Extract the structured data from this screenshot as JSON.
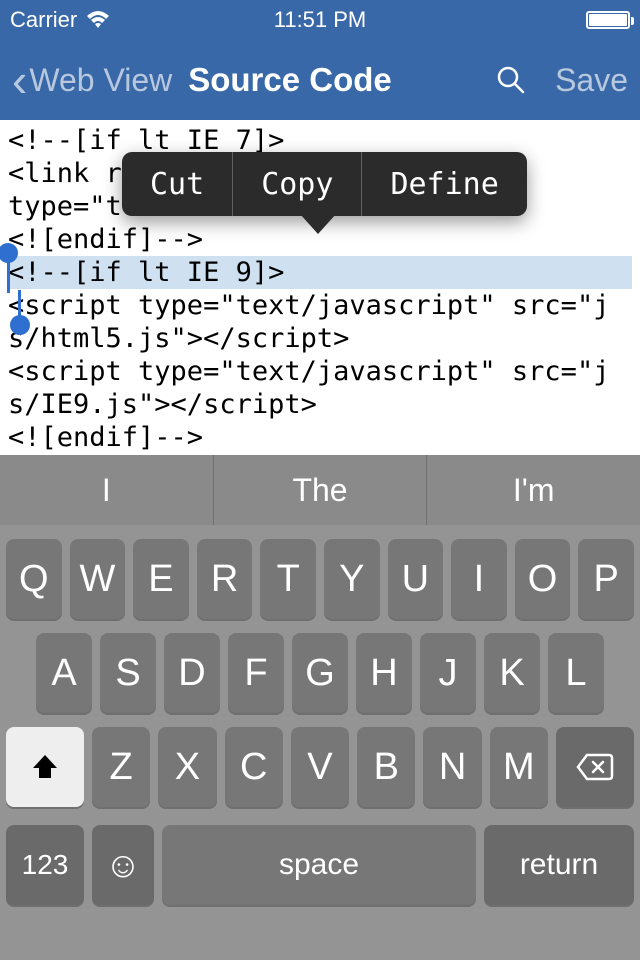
{
  "status": {
    "carrier": "Carrier",
    "time": "11:51 PM"
  },
  "nav": {
    "back_label": "Web View",
    "title": "Source Code",
    "save_label": "Save"
  },
  "code": {
    "lines": [
      "<!--[if lt IE 7]>",
      "<link rel=",
      "type=\"te",
      "<![endif]-->",
      "<!--[if lt IE 9]>",
      "<script type=\"text/javascript\" src=\"js/html5.js\"></script>",
      "<script type=\"text/javascript\" src=\"js/IE9.js\"></script>",
      "<![endif]-->"
    ],
    "selection_line_index": 4
  },
  "edit_menu": {
    "cut": "Cut",
    "copy": "Copy",
    "define": "Define"
  },
  "keyboard": {
    "predictions": [
      "I",
      "The",
      "I'm"
    ],
    "row1": [
      "Q",
      "W",
      "E",
      "R",
      "T",
      "Y",
      "U",
      "I",
      "O",
      "P"
    ],
    "row2": [
      "A",
      "S",
      "D",
      "F",
      "G",
      "H",
      "J",
      "K",
      "L"
    ],
    "row3": [
      "Z",
      "X",
      "C",
      "V",
      "B",
      "N",
      "M"
    ],
    "numbers_label": "123",
    "space_label": "space",
    "return_label": "return"
  },
  "colors": {
    "navbar": "#3968a8",
    "selection": "#cfe1f0",
    "handle": "#2f6fd0",
    "keyboard_bg": "#949494",
    "key_bg": "#777777",
    "key_special_bg": "#6a6a6a"
  }
}
